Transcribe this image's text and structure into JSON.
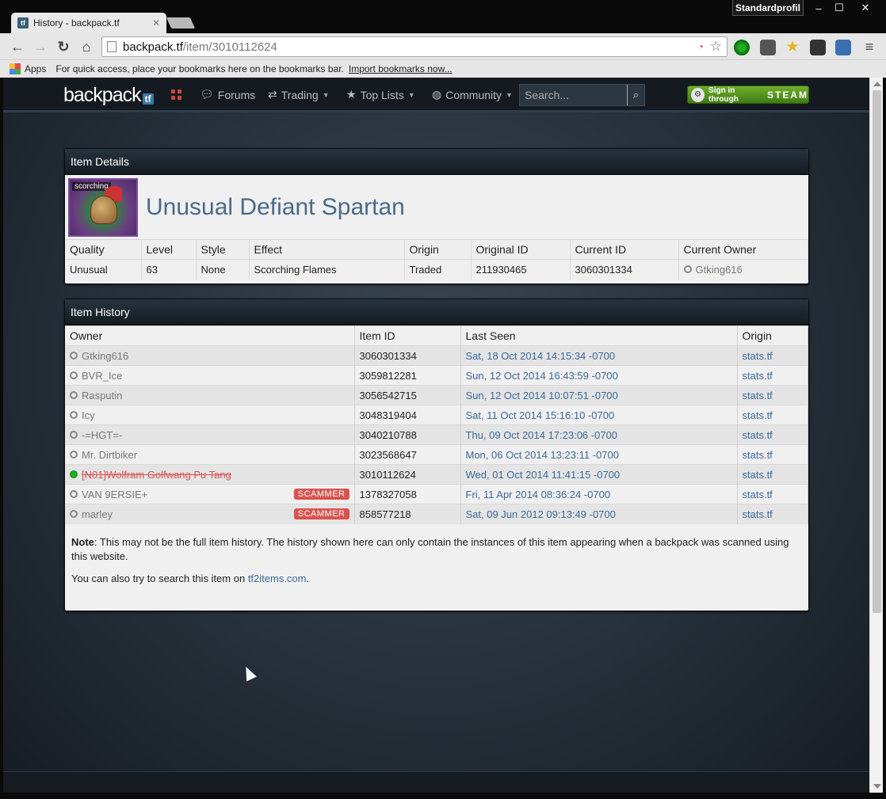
{
  "browser": {
    "tab_title": "History - backpack.tf",
    "tab_favicon": "tf",
    "profile_name": "Standardprofil",
    "url_host": "backpack.tf",
    "url_path": "/item/3010112624",
    "bookmarks_apps": "Apps",
    "bookmarks_hint": "For quick access, place your bookmarks here on the bookmarks bar.",
    "bookmarks_import": "Import bookmarks now..."
  },
  "site_nav": {
    "logo_main": "backpack",
    "logo_suffix": "tf",
    "forums": "Forums",
    "trading": "Trading",
    "top_lists": "Top Lists",
    "community": "Community",
    "search_placeholder": "Search...",
    "steam_sign_in": "Sign in through",
    "steam_word": "STEAM"
  },
  "item_details": {
    "heading": "Item Details",
    "badge": "scorching",
    "name": "Unusual Defiant Spartan",
    "columns": [
      "Quality",
      "Level",
      "Style",
      "Effect",
      "Origin",
      "Original ID",
      "Current ID",
      "Current Owner"
    ],
    "values": {
      "quality": "Unusual",
      "level": "63",
      "style": "None",
      "effect": "Scorching Flames",
      "origin": "Traded",
      "original_id": "211930465",
      "current_id": "3060301334",
      "current_owner": "Gtking616"
    }
  },
  "item_history": {
    "heading": "Item History",
    "columns": {
      "owner": "Owner",
      "item_id": "Item ID",
      "last_seen": "Last Seen",
      "origin": "Origin"
    },
    "scammer_label": "SCAMMER",
    "rows": [
      {
        "owner": "Gtking616",
        "item_id": "3060301334",
        "last_seen": "Sat, 18 Oct 2014 14:15:34 -0700",
        "origin": "stats.tf"
      },
      {
        "owner": "BVR_Ice",
        "item_id": "3059812281",
        "last_seen": "Sun, 12 Oct 2014 16:43:59 -0700",
        "origin": "stats.tf"
      },
      {
        "owner": "Rasputin",
        "item_id": "3056542715",
        "last_seen": "Sun, 12 Oct 2014 10:07:51 -0700",
        "origin": "stats.tf"
      },
      {
        "owner": "Icy",
        "item_id": "3048319404",
        "last_seen": "Sat, 11 Oct 2014 15:16:10 -0700",
        "origin": "stats.tf"
      },
      {
        "owner": "-=HGT=-",
        "item_id": "3040210788",
        "last_seen": "Thu, 09 Oct 2014 17:23:06 -0700",
        "origin": "stats.tf"
      },
      {
        "owner": "Mr. Dirtbiker",
        "item_id": "3023568647",
        "last_seen": "Mon, 06 Oct 2014 13:23:11 -0700",
        "origin": "stats.tf"
      },
      {
        "owner": "[N01]Wolfram Golfwang Pu Tang",
        "item_id": "3010112624",
        "last_seen": "Wed, 01 Oct 2014 11:41:15 -0700",
        "origin": "stats.tf"
      },
      {
        "owner": "VAN 9ERSIE+",
        "item_id": "1378327058",
        "last_seen": "Fri, 11 Apr 2014 08:36:24 -0700",
        "origin": "stats.tf"
      },
      {
        "owner": "marley",
        "item_id": "858577218",
        "last_seen": "Sat, 09 Jun 2012 09:13:49 -0700",
        "origin": "stats.tf"
      }
    ],
    "note_label": "Note",
    "note_text": ": This may not be the full item history. The history shown here can only contain the instances of this item appearing when a backpack was scanned using this website.",
    "search_text": "You can also try to search this item on ",
    "search_link": "tf2items.com",
    "search_end": "."
  },
  "colors": {
    "accent_link": "#3b6a9a",
    "scammer_badge": "#d9534f",
    "online_dot": "#21b521",
    "steam_green": "#5a9a22"
  }
}
